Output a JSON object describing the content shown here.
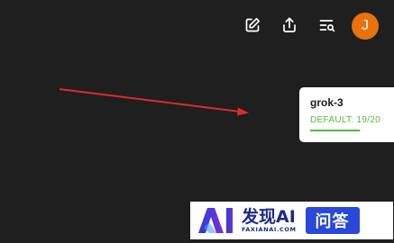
{
  "toolbar": {
    "icons": [
      "edit-icon",
      "share-icon",
      "search-list-icon"
    ],
    "avatar_initial": "J",
    "avatar_color": "#e8720c"
  },
  "model_card": {
    "name": "grok-3",
    "usage_label": "DEFAULT: 19/20",
    "usage_fraction": 0.95,
    "accent_color": "#56b83b"
  },
  "annotation": {
    "type": "arrow",
    "color": "#e02a2a"
  },
  "watermark": {
    "logo": "AI",
    "name": "发现AI",
    "domain": "FAXIANAI.COM",
    "badge": "问答"
  }
}
